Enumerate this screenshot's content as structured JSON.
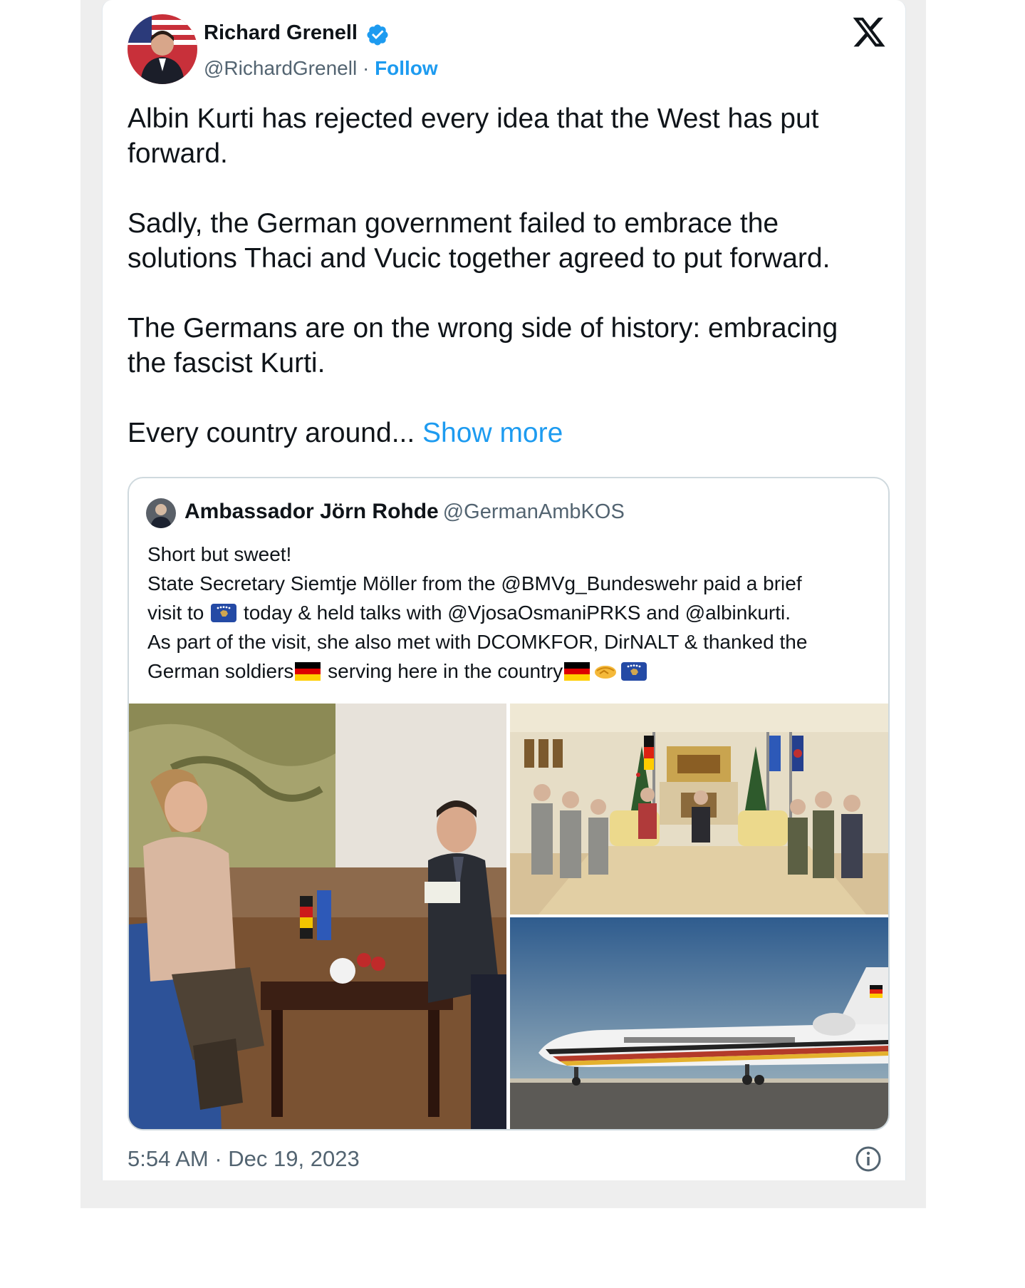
{
  "tweet": {
    "author_name": "Richard Grenell",
    "author_handle": "@RichardGrenell",
    "separator": " · ",
    "follow_label": "Follow",
    "text": "Albin Kurti has rejected every idea that the West has put\nforward.\n\nSadly, the German government failed to embrace the\nsolutions Thaci and Vucic together agreed to put forward.\n\nThe Germans are on the wrong side of history: embracing\nthe fascist Kurti.\n\nEvery country around... ",
    "show_more_label": "Show more",
    "timestamp": "5:54 AM · Dec 19, 2023"
  },
  "quoted_tweet": {
    "author_name": "Ambassador Jörn Rohde",
    "author_handle": "@GermanAmbKOS",
    "line1": "Short but sweet!",
    "line2": "State Secretary Siemtje Möller from the @BMVg_Bundeswehr paid a brief",
    "line3a": "visit to ",
    "line3b": " today & held talks with @VjosaOsmaniPRKS and @albinkurti.",
    "line4": "As part of the visit, she also met with DCOMKFOR, DirNALT & thanked the",
    "line5a": "German soldiers",
    "line5b": " serving here in the country"
  },
  "icons": {
    "logo": "x-logo-icon",
    "verified": "verified-badge-icon",
    "info": "info-icon",
    "flags": [
      "kosovo-flag-icon",
      "germany-flag-icon",
      "handshake-icon"
    ]
  },
  "colors": {
    "link": "#1d9bf0",
    "text": "#0f1419",
    "secondary": "#536471",
    "border": "#cfd9de"
  }
}
